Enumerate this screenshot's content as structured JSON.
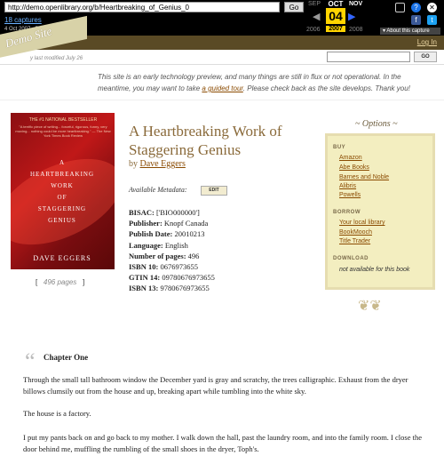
{
  "wayback": {
    "url": "http://demo.openlibrary.org/b/Heartbreaking_of_Genius_0",
    "go_label": "Go",
    "captures_label": "18 captures",
    "date_range": "4 Oct 2007 - 5 Jun 2008",
    "prev_month": "SEP",
    "cur_month": "OCT",
    "next_month": "NOV",
    "day": "04",
    "prev_year": "2006",
    "cur_year": "2007",
    "next_year": "2008",
    "about_label": "About this capture"
  },
  "header": {
    "demo_label": "Demo Site",
    "login_label": "Log In",
    "modified_text": "y last modified July 26",
    "search_placeholder": "",
    "search_go": "GO"
  },
  "notice": {
    "text_before": "This site is an early technology preview, and many things are still in flux or not operational. In the meantime, you may want to take ",
    "link": "a guided tour",
    "text_after": ". Please check back as the site develops. Thank you!"
  },
  "cover": {
    "award": "THE #1 NATIONAL BESTSELLER",
    "blurb": "\"A terrific piece of writing... forceful, rigorous, funny, very moving... nothing could be more heartbreaking.\" — The New York Times Book Review",
    "title_lines": [
      "A",
      "HEARTBREAKING",
      "WORK",
      "OF",
      "STAGGERING",
      "GENIUS"
    ],
    "author": "DAVE EGGERS"
  },
  "pages": {
    "open": "[",
    "value": "496 pages",
    "close": "]"
  },
  "book": {
    "title": "A Heartbreaking Work of Staggering Genius",
    "by": "by",
    "author": "Dave Eggers",
    "available_metadata": "Available Metadata:",
    "edit_label": "EDIT",
    "meta": [
      {
        "label": "BISAC:",
        "value": "['BIO000000']"
      },
      {
        "label": "Publisher:",
        "value": "Knopf Canada"
      },
      {
        "label": "Publish Date:",
        "value": "20010213"
      },
      {
        "label": "Language:",
        "value": "English"
      },
      {
        "label": "Number of pages:",
        "value": "496"
      },
      {
        "label": "ISBN 10:",
        "value": "0676973655"
      },
      {
        "label": "GTIN 14:",
        "value": "09780676973655"
      },
      {
        "label": "ISBN 13:",
        "value": "9780676973655"
      }
    ]
  },
  "options": {
    "title": "~ Options ~",
    "buy_label": "BUY",
    "buy": [
      "Amazon",
      "Abe Books",
      "Barnes and Noble",
      "Alibris",
      "Powells"
    ],
    "borrow_label": "BORROW",
    "borrow": [
      "Your local library",
      "BookMooch",
      "Title Trader"
    ],
    "download_label": "DOWNLOAD",
    "download_text": "not available for this book"
  },
  "excerpt": {
    "quote_mark": "“",
    "chapter": "Chapter One",
    "p1": "Through the small tall bathroom window the December yard is gray and scratchy, the trees calligraphic. Exhaust from the dryer billows clumsily out from the house and up, breaking apart while tumbling into the white sky.",
    "p2": "The house is a factory.",
    "p3": "I put my pants back on and go back to my mother. I walk down the hall, past the laundry room, and into the family room. I close the door behind me, muffling the rumbling of the small shoes in the dryer, Toph's."
  }
}
